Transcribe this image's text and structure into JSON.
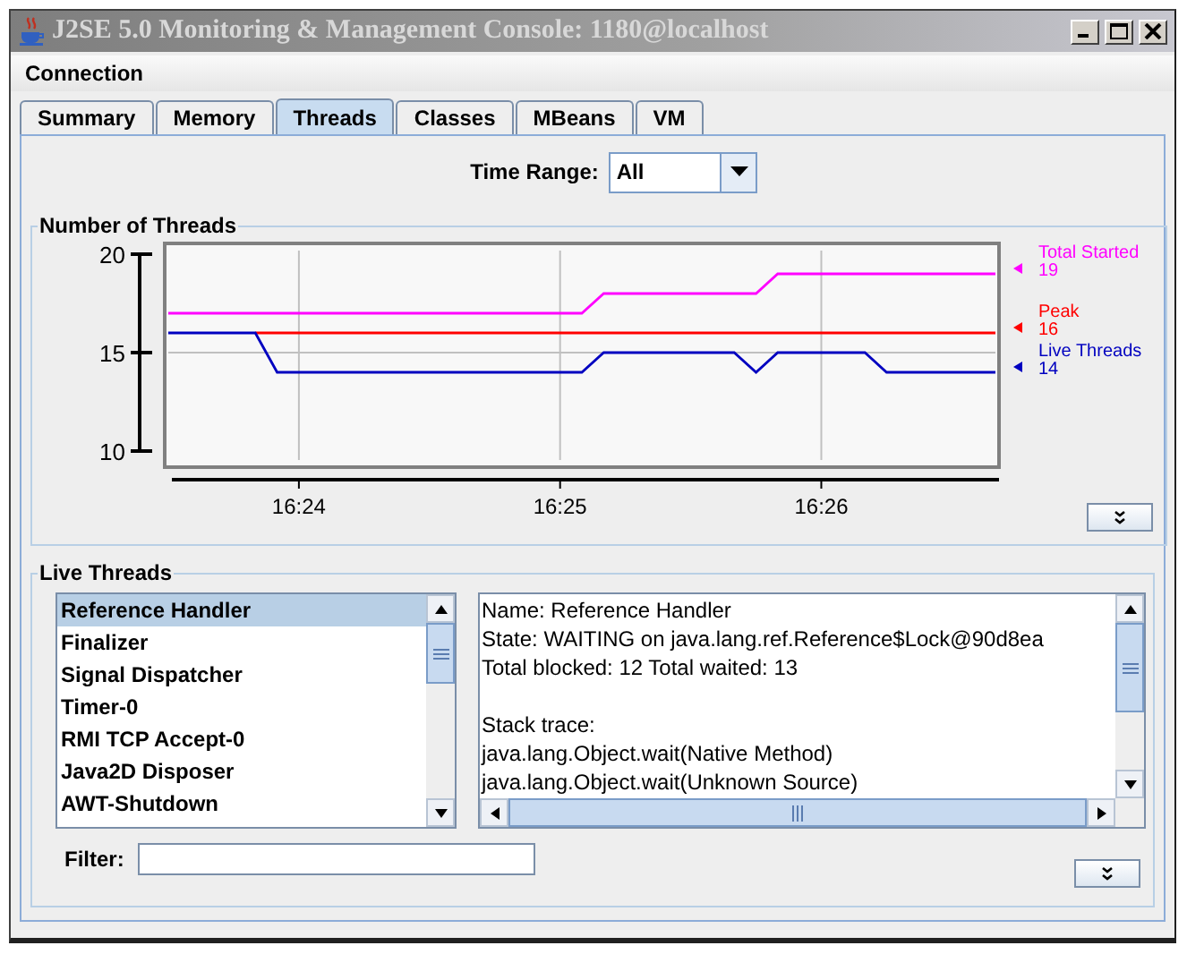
{
  "window": {
    "title": "J2SE 5.0 Monitoring & Management Console: 1180@localhost"
  },
  "menu": [
    "Connection"
  ],
  "tabs": [
    {
      "label": "Summary",
      "selected": false
    },
    {
      "label": "Memory",
      "selected": false
    },
    {
      "label": "Threads",
      "selected": true
    },
    {
      "label": "Classes",
      "selected": false
    },
    {
      "label": "MBeans",
      "selected": false
    },
    {
      "label": "VM",
      "selected": false
    }
  ],
  "time_range": {
    "label": "Time Range:",
    "value": "All"
  },
  "threads_chart": {
    "title": "Number of Threads",
    "legend_readings": [
      "19",
      "16",
      "14"
    ],
    "chart_data": {
      "type": "line",
      "categories": [
        null,
        null,
        null,
        null,
        null,
        null,
        "16:24",
        null,
        null,
        null,
        null,
        null,
        null,
        null,
        null,
        null,
        null,
        null,
        "16:25",
        null,
        null,
        null,
        null,
        null,
        null,
        null,
        null,
        null,
        null,
        null,
        "16:26",
        null,
        null,
        null,
        null,
        null,
        null,
        null,
        null
      ],
      "series": [
        {
          "name": "Total Started",
          "color": "#ff00ff",
          "values": [
            17,
            17,
            17,
            17,
            17,
            17,
            17,
            17,
            17,
            17,
            17,
            17,
            17,
            17,
            17,
            17,
            17,
            17,
            17,
            17,
            18,
            18,
            18,
            18,
            18,
            18,
            18,
            18,
            19,
            19,
            19,
            19,
            19,
            19,
            19,
            19,
            19,
            19,
            19
          ]
        },
        {
          "name": "Peak",
          "color": "#ff0000",
          "values": [
            null,
            null,
            null,
            null,
            16,
            16,
            16,
            16,
            16,
            16,
            16,
            16,
            16,
            16,
            16,
            16,
            16,
            16,
            16,
            16,
            16,
            16,
            16,
            16,
            16,
            16,
            16,
            16,
            16,
            16,
            16,
            16,
            16,
            16,
            16,
            16,
            16,
            16,
            16
          ]
        },
        {
          "name": "Live Threads",
          "color": "#0000c0",
          "values": [
            16,
            16,
            16,
            16,
            16,
            14,
            14,
            14,
            14,
            14,
            14,
            14,
            14,
            14,
            14,
            14,
            14,
            14,
            14,
            14,
            15,
            15,
            15,
            15,
            15,
            15,
            15,
            14,
            15,
            15,
            15,
            15,
            15,
            14,
            14,
            14,
            14,
            14,
            14
          ]
        }
      ],
      "ylim": [
        10,
        20
      ],
      "yticks": [
        10,
        15,
        20
      ],
      "grid": true
    }
  },
  "live_threads": {
    "title": "Live Threads",
    "threads": [
      {
        "name": "Reference Handler",
        "selected": true
      },
      {
        "name": "Finalizer",
        "selected": false
      },
      {
        "name": "Signal Dispatcher",
        "selected": false
      },
      {
        "name": "Timer-0",
        "selected": false
      },
      {
        "name": "RMI TCP Accept-0",
        "selected": false
      },
      {
        "name": "Java2D Disposer",
        "selected": false
      },
      {
        "name": "AWT-Shutdown",
        "selected": false
      }
    ],
    "details": {
      "info": [
        "Name: Reference Handler",
        "State: WAITING on java.lang.ref.Reference$Lock@90d8ea",
        "Total blocked: 12  Total waited: 13"
      ],
      "stack_heading": "Stack trace:",
      "stack": [
        "java.lang.Object.wait(Native Method)",
        "java.lang.Object.wait(Unknown Source)"
      ]
    },
    "filter": {
      "label": "Filter:"
    }
  }
}
